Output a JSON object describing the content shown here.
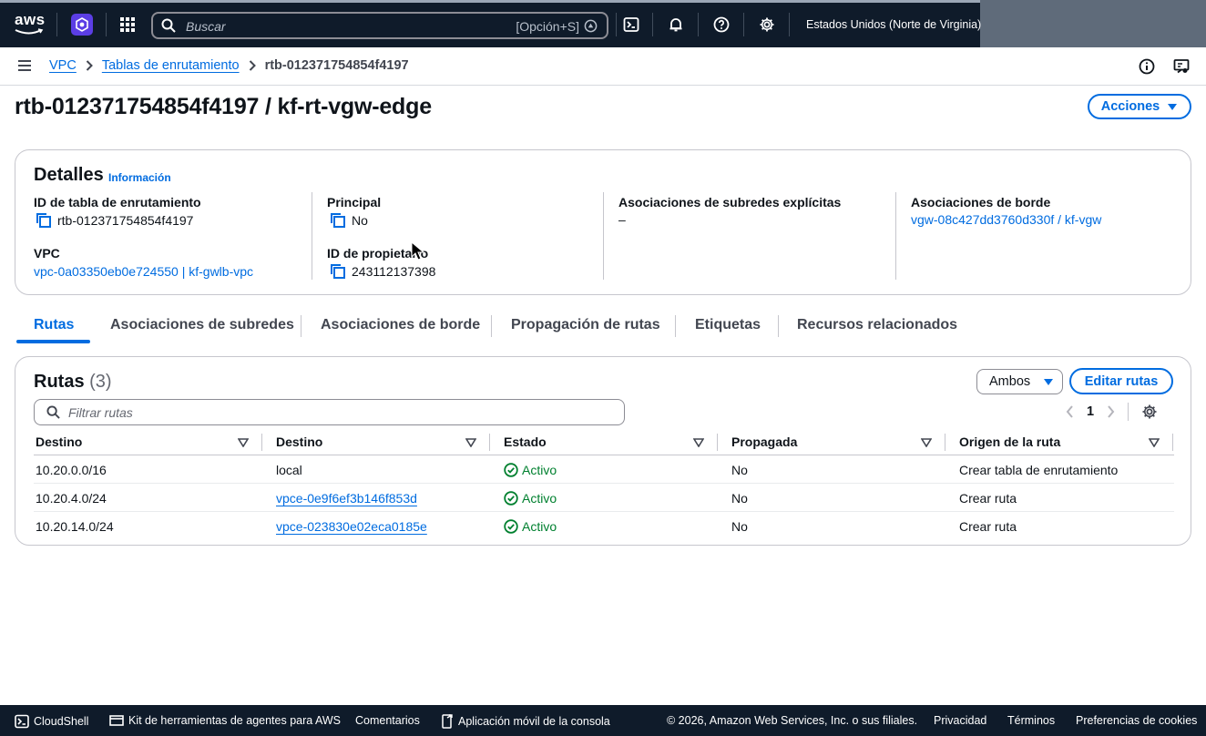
{
  "topnav": {
    "logo_text": "aws",
    "search_placeholder": "Buscar",
    "search_shortcut": "[Opción+S]",
    "region": "Estados Unidos (Norte de Virginia)"
  },
  "breadcrumb": {
    "items": [
      "VPC",
      "Tablas de enrutamiento"
    ],
    "current": "rtb-012371754854f4197"
  },
  "page": {
    "title": "rtb-012371754854f4197 / kf-rt-vgw-edge",
    "actions_label": "Acciones"
  },
  "details": {
    "heading": "Detalles",
    "info_label": "Información",
    "fields": {
      "route_table_id_label": "ID de tabla de enrutamiento",
      "route_table_id": "rtb-012371754854f4197",
      "vpc_label": "VPC",
      "vpc": "vpc-0a03350eb0e724550 | kf-gwlb-vpc",
      "main_label": "Principal",
      "main": "No",
      "owner_label": "ID de propietario",
      "owner": "243112137398",
      "explicit_subnets_label": "Asociaciones de subredes explícitas",
      "explicit_subnets": "–",
      "edge_assoc_label": "Asociaciones de borde",
      "edge_assoc": "vgw-08c427dd3760d330f / kf-vgw"
    }
  },
  "tabs": [
    "Rutas",
    "Asociaciones de subredes",
    "Asociaciones de borde",
    "Propagación de rutas",
    "Etiquetas",
    "Recursos relacionados"
  ],
  "routes": {
    "heading": "Rutas",
    "count": "(3)",
    "filter_select": "Ambos",
    "edit_label": "Editar rutas",
    "filter_placeholder": "Filtrar rutas",
    "page_number": "1",
    "columns": [
      "Destino",
      "Destino",
      "Estado",
      "Propagada",
      "Origen de la ruta"
    ],
    "rows": [
      {
        "destination": "10.20.0.0/16",
        "target": "local",
        "status": "Activo",
        "propagated": "No",
        "origin": "Crear tabla de enrutamiento"
      },
      {
        "destination": "10.20.4.0/24",
        "target": "vpce-0e9f6ef3b146f853d",
        "status": "Activo",
        "propagated": "No",
        "origin": "Crear ruta"
      },
      {
        "destination": "10.20.14.0/24",
        "target": "vpce-023830e02eca0185e",
        "status": "Activo",
        "propagated": "No",
        "origin": "Crear ruta"
      }
    ]
  },
  "footer": {
    "cloudshell": "CloudShell",
    "kit": "Kit de herramientas de agentes para AWS",
    "comments": "Comentarios",
    "mobile": "Aplicación móvil de la consola",
    "copyright": "© 2026, Amazon Web Services, Inc. o sus filiales.",
    "privacy": "Privacidad",
    "terms": "Términos",
    "cookies": "Preferencias de cookies"
  }
}
